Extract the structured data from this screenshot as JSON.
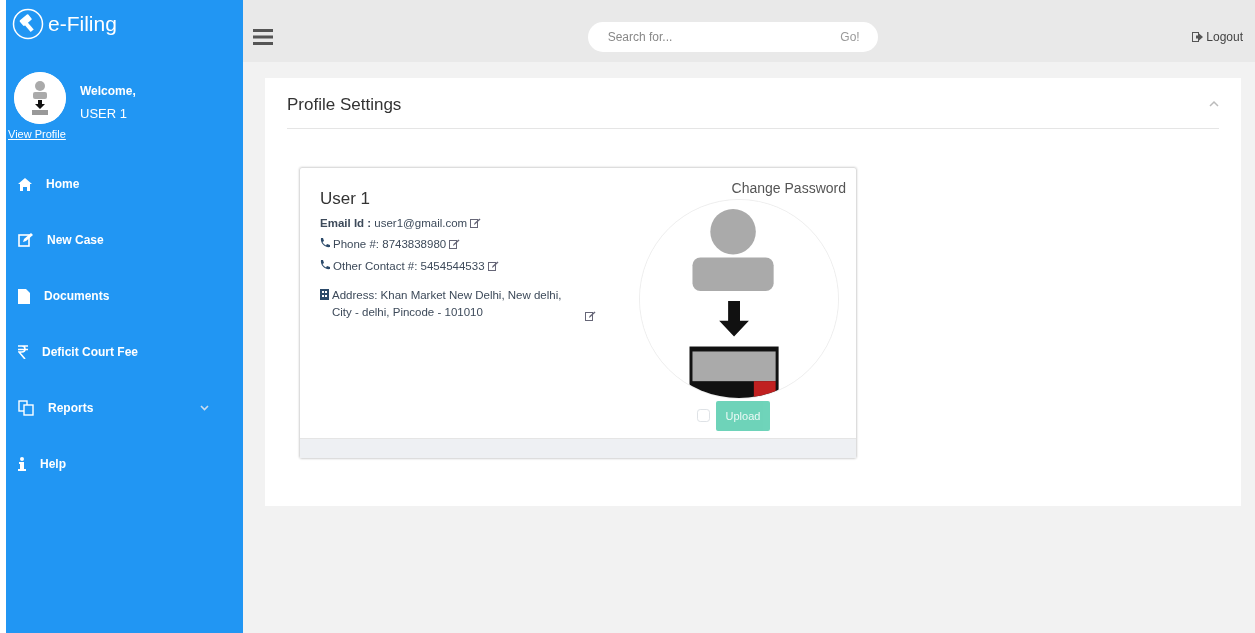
{
  "brand": "e-Filing",
  "user": {
    "welcome": "Welcome,",
    "name": "USER 1",
    "link": "View Profile"
  },
  "menu": [
    {
      "kind": "link",
      "label": "Home"
    },
    {
      "kind": "link",
      "label": "New Case"
    },
    {
      "kind": "link",
      "label": "Documents"
    },
    {
      "kind": "link",
      "label": "Deficit Court Fee"
    },
    {
      "kind": "dropdown",
      "label": "Reports"
    },
    {
      "kind": "link",
      "label": "Help"
    }
  ],
  "search": {
    "placeholder": "Search for...",
    "button": "Go!"
  },
  "logout": "Logout",
  "panel": {
    "title": "Profile Settings",
    "profile": {
      "name": "User 1",
      "change_password": "Change Password",
      "fields": [
        {
          "kind": "email",
          "label": "Email Id :",
          "value": "user1@gmail.com"
        },
        {
          "kind": "phone",
          "label": "Phone #:",
          "value": "8743838980"
        },
        {
          "kind": "phone",
          "label": "Other Contact #:",
          "value": "5454544533"
        },
        {
          "kind": "address",
          "label": "Address:",
          "value": "Khan Market New Delhi, New delhi, City - delhi, Pincode - 101010"
        }
      ],
      "checkbox": {
        "checked": false
      },
      "upload": {
        "label": "Upload",
        "disabled": true
      }
    }
  }
}
